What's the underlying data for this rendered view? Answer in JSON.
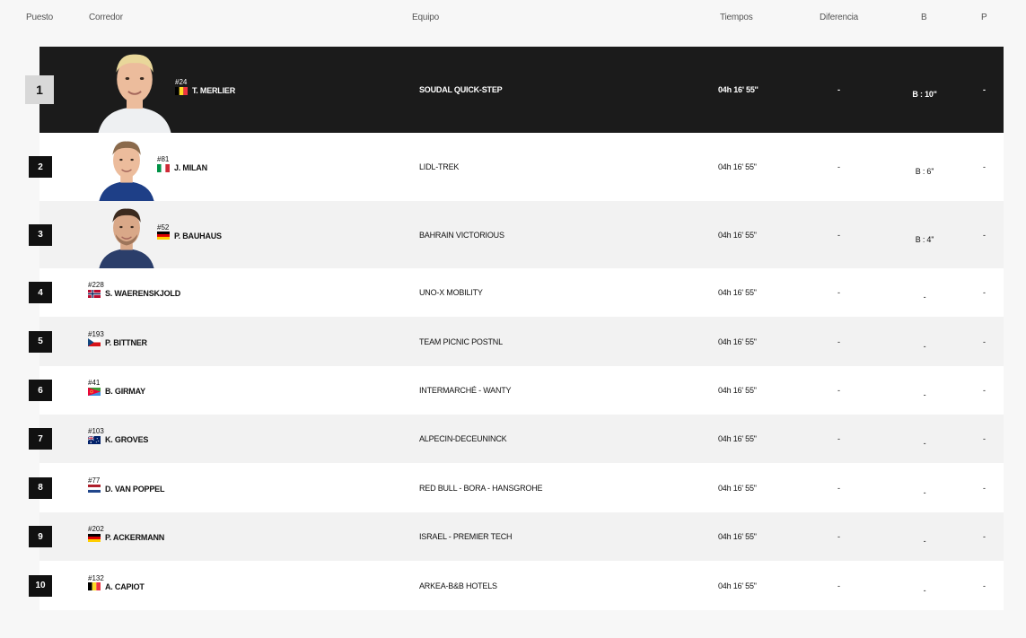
{
  "columns": {
    "puesto": "Puesto",
    "corredor": "Corredor",
    "equipo": "Equipo",
    "tiempos": "Tiempos",
    "diferencia": "Diferencia",
    "b": "B",
    "p": "P"
  },
  "rows": [
    {
      "rank": "1",
      "bib": "#24",
      "name": "T. MERLIER",
      "flag": "belgium",
      "team": "SOUDAL QUICK-STEP",
      "time": "04h 16' 55''",
      "gap": "-",
      "bonus": "B : 10''",
      "penalty": "-",
      "photo": "blond"
    },
    {
      "rank": "2",
      "bib": "#81",
      "name": "J. MILAN",
      "flag": "italy",
      "team": "LIDL-TREK",
      "time": "04h 16' 55''",
      "gap": "-",
      "bonus": "B : 6''",
      "penalty": "-",
      "photo": "short"
    },
    {
      "rank": "3",
      "bib": "#52",
      "name": "P. BAUHAUS",
      "flag": "germany",
      "team": "BAHRAIN VICTORIOUS",
      "time": "04h 16' 55''",
      "gap": "-",
      "bonus": "B : 4''",
      "penalty": "-",
      "photo": "dark"
    },
    {
      "rank": "4",
      "bib": "#228",
      "name": "S. WAERENSKJOLD",
      "flag": "norway",
      "team": "UNO-X MOBILITY",
      "time": "04h 16' 55''",
      "gap": "-",
      "bonus": "-",
      "penalty": "-"
    },
    {
      "rank": "5",
      "bib": "#193",
      "name": "P. BITTNER",
      "flag": "czech",
      "team": "TEAM PICNIC POSTNL",
      "time": "04h 16' 55''",
      "gap": "-",
      "bonus": "-",
      "penalty": "-"
    },
    {
      "rank": "6",
      "bib": "#41",
      "name": "B. GIRMAY",
      "flag": "eritrea",
      "team": "INTERMARCHÉ - WANTY",
      "time": "04h 16' 55''",
      "gap": "-",
      "bonus": "-",
      "penalty": "-"
    },
    {
      "rank": "7",
      "bib": "#103",
      "name": "K. GROVES",
      "flag": "australia",
      "team": "ALPECIN-DECEUNINCK",
      "time": "04h 16' 55''",
      "gap": "-",
      "bonus": "-",
      "penalty": "-"
    },
    {
      "rank": "8",
      "bib": "#77",
      "name": "D. VAN POPPEL",
      "flag": "netherlands",
      "team": "RED BULL - BORA - HANSGROHE",
      "time": "04h 16' 55''",
      "gap": "-",
      "bonus": "-",
      "penalty": "-"
    },
    {
      "rank": "9",
      "bib": "#202",
      "name": "P. ACKERMANN",
      "flag": "germany",
      "team": "ISRAEL - PREMIER TECH",
      "time": "04h 16' 55''",
      "gap": "-",
      "bonus": "-",
      "penalty": "-"
    },
    {
      "rank": "10",
      "bib": "#132",
      "name": "A. CAPIOT",
      "flag": "belgium",
      "team": "ARKEA-B&B HOTELS",
      "time": "04h 16' 55''",
      "gap": "-",
      "bonus": "-",
      "penalty": "-"
    }
  ]
}
